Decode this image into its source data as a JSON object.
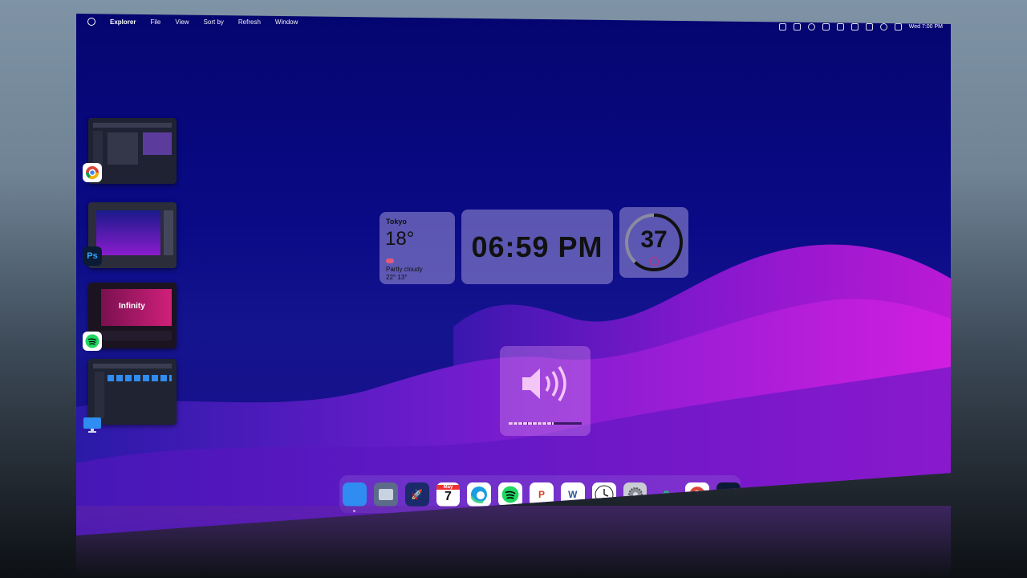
{
  "menubar": {
    "app": "Explorer",
    "items": [
      "File",
      "View",
      "Sort by",
      "Refresh",
      "Window"
    ],
    "clock": "Wed 7:00 PM"
  },
  "weather": {
    "city": "Tokyo",
    "temp": "18°",
    "condition": "Partly cloudy",
    "range": "22° 13°"
  },
  "clock": {
    "time": "06:59 PM"
  },
  "gauge": {
    "value": "37",
    "level": 0.62
  },
  "volume": {
    "level": 0.62
  },
  "thumbnails": [
    {
      "app": "chrome",
      "badge_icon": "chrome-icon"
    },
    {
      "app": "photoshop",
      "badge_text": "Ps"
    },
    {
      "app": "spotify",
      "title": "Infinity",
      "badge_icon": "spotify-icon"
    },
    {
      "app": "explorer",
      "badge_icon": "monitor-icon"
    }
  ],
  "dock": {
    "calendar_month": "May",
    "calendar_day": "7",
    "ps_label": "Ps",
    "ppt_label": "P",
    "word_label": "W"
  },
  "colors": {
    "desktop": "#0a0a86",
    "wave": "#b815d8",
    "widget": "#c7bde6"
  }
}
